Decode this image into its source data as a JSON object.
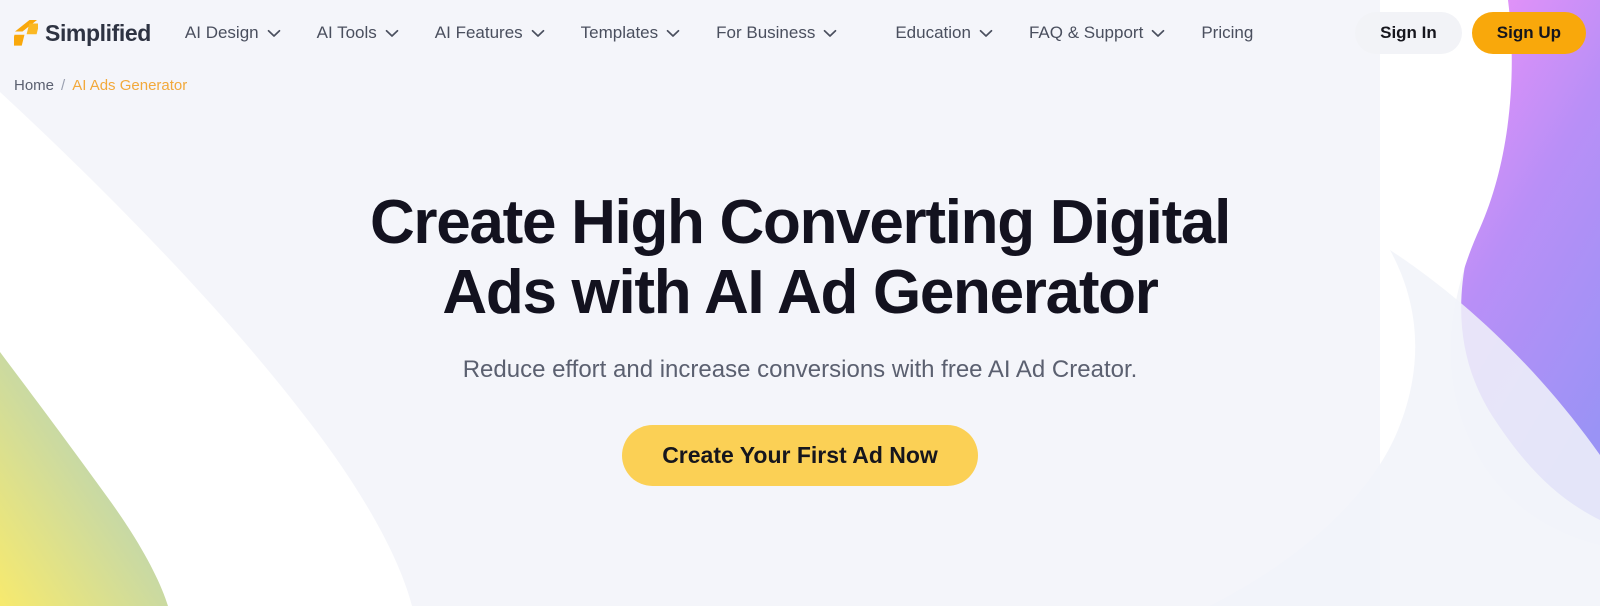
{
  "brand": {
    "name": "Simplified",
    "logo_icon": "simplified-lightning-logo"
  },
  "nav": {
    "items": [
      {
        "label": "AI Design",
        "has_dropdown": true,
        "icon": "chevron-down-icon"
      },
      {
        "label": "AI Tools",
        "has_dropdown": true,
        "icon": "chevron-down-icon"
      },
      {
        "label": "AI Features",
        "has_dropdown": true,
        "icon": "chevron-down-icon"
      },
      {
        "label": "Templates",
        "has_dropdown": true,
        "icon": "chevron-down-icon"
      },
      {
        "label": "For Business",
        "has_dropdown": true,
        "icon": "chevron-down-icon"
      },
      {
        "label": "Education",
        "has_dropdown": true,
        "icon": "chevron-down-icon"
      },
      {
        "label": "FAQ & Support",
        "has_dropdown": true,
        "icon": "chevron-down-icon"
      },
      {
        "label": "Pricing",
        "has_dropdown": false,
        "icon": ""
      }
    ]
  },
  "auth": {
    "sign_in_label": "Sign In",
    "sign_up_label": "Sign Up"
  },
  "breadcrumb": {
    "home_label": "Home",
    "separator": "/",
    "current_label": "AI Ads Generator"
  },
  "hero": {
    "title_line_1": "Create High Converting Digital",
    "title_line_2": "Ads with AI Ad Generator",
    "subtitle": "Reduce effort and increase conversions with free AI Ad Creator.",
    "cta_label": "Create Your First Ad Now"
  },
  "colors": {
    "page_background": "#f4f5fa",
    "brand_orange": "#f9a80b",
    "logo_orange": "#f9a80b",
    "cta_yellow": "#fbd055",
    "breadcrumb_active": "#f2a93b",
    "heading_navy": "#13121f",
    "body_gray": "#5b6070",
    "signin_gray": "#f2f3f7",
    "blob_purple_top": "#de8ff6",
    "blob_purple_bottom": "#9a93f5",
    "blob_yellow": "#f5e96f",
    "blob_teal": "#8fc7bd",
    "wave_white": "#ffffff"
  }
}
